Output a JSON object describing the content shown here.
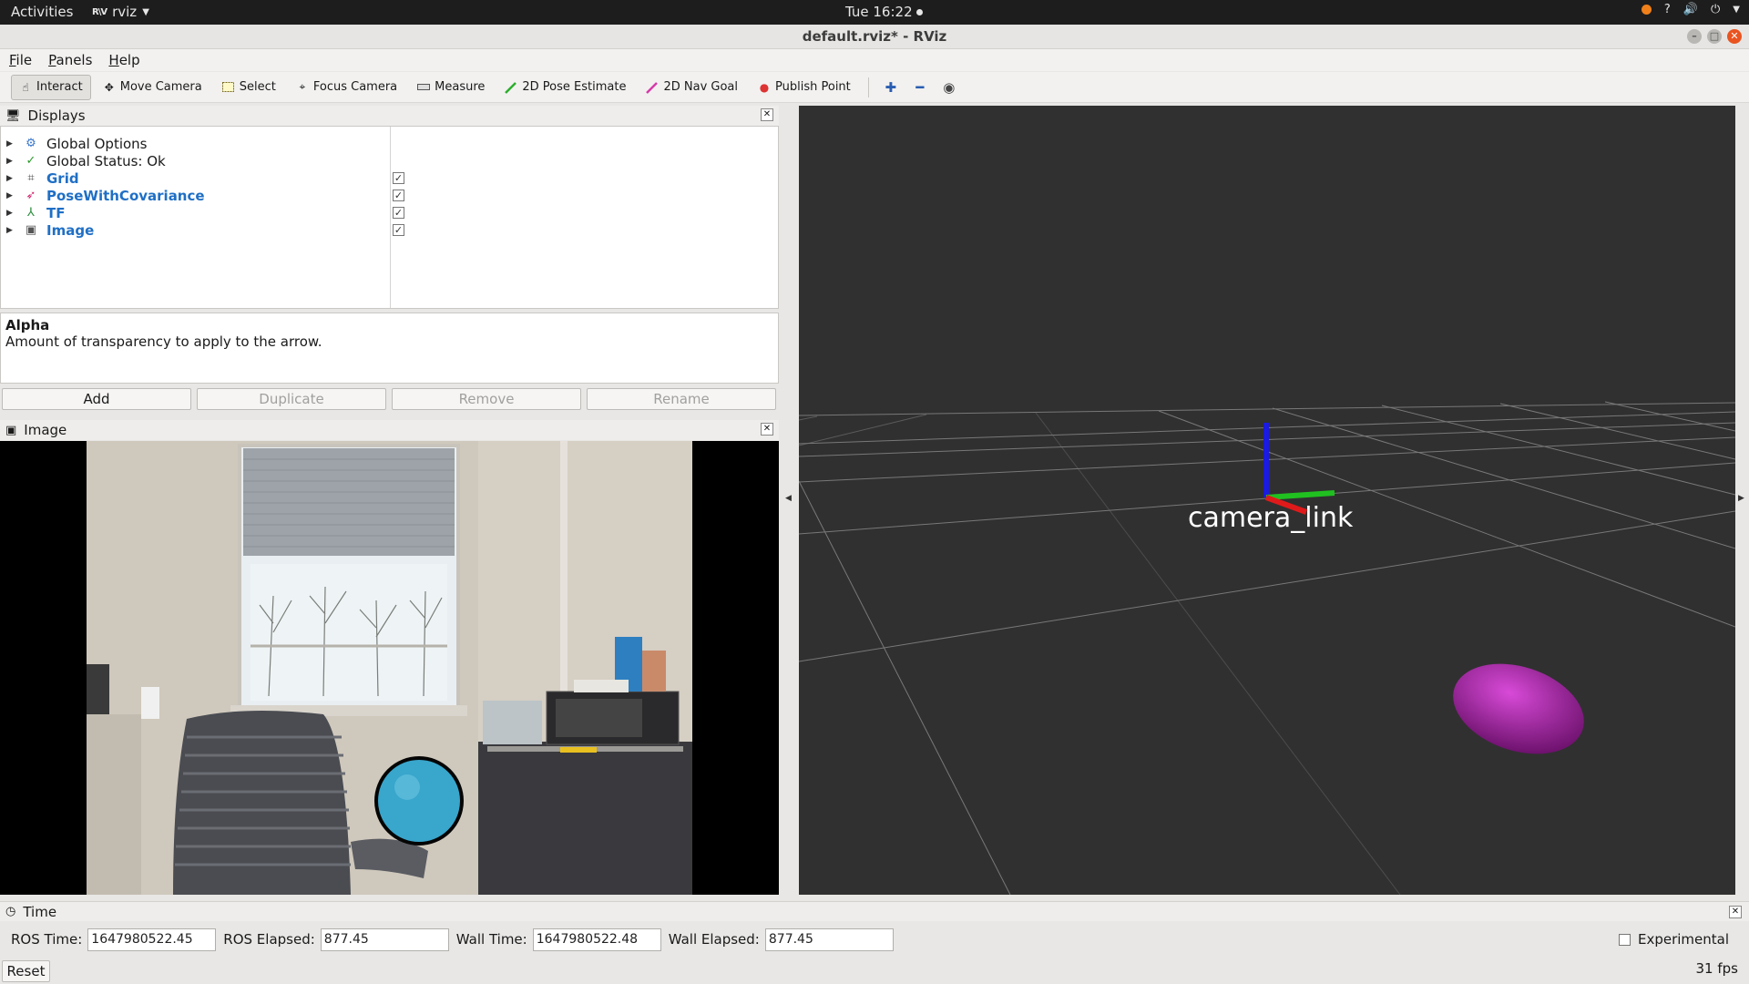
{
  "topbar": {
    "activities": "Activities",
    "app_name": "rviz",
    "clock": "Tue 16:22"
  },
  "window": {
    "title": "default.rviz* - RViz"
  },
  "menu": [
    "File",
    "Panels",
    "Help"
  ],
  "toolbar": {
    "interact": "Interact",
    "move_camera": "Move Camera",
    "select": "Select",
    "focus_camera": "Focus Camera",
    "measure": "Measure",
    "pose_estimate": "2D Pose Estimate",
    "nav_goal": "2D Nav Goal",
    "publish_point": "Publish Point"
  },
  "displays": {
    "title": "Displays",
    "items": [
      {
        "label": "Global Options",
        "icon": "gear-icon"
      },
      {
        "label": "Global Status: Ok",
        "icon": "check-icon"
      },
      {
        "label": "Grid",
        "icon": "grid-icon",
        "checked": true
      },
      {
        "label": "PoseWithCovariance",
        "icon": "pose-icon",
        "checked": true
      },
      {
        "label": "TF",
        "icon": "tf-icon",
        "checked": true
      },
      {
        "label": "Image",
        "icon": "image-icon",
        "checked": true
      }
    ],
    "check_mark": "✓",
    "description_title": "Alpha",
    "description_text": "Amount of transparency to apply to the arrow.",
    "buttons": {
      "add": "Add",
      "duplicate": "Duplicate",
      "remove": "Remove",
      "rename": "Rename"
    }
  },
  "image_panel": {
    "title": "Image"
  },
  "view3d": {
    "frame_label": "camera_link",
    "colors": {
      "background": "#303030",
      "ellipsoid": "#b020b0"
    }
  },
  "time_panel": {
    "title": "Time",
    "ros_time_label": "ROS Time:",
    "ros_time": "1647980522.45",
    "ros_elapsed_label": "ROS Elapsed:",
    "ros_elapsed": "877.45",
    "wall_time_label": "Wall Time:",
    "wall_time": "1647980522.48",
    "wall_elapsed_label": "Wall Elapsed:",
    "wall_elapsed": "877.45",
    "experimental": "Experimental",
    "reset": "Reset",
    "fps": "31 fps"
  }
}
